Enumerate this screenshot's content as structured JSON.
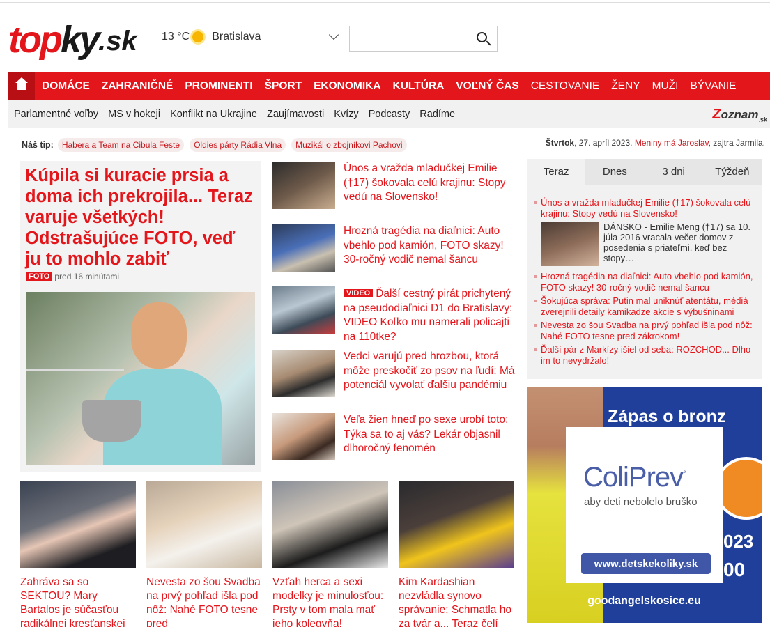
{
  "header": {
    "logo_parts": [
      "top",
      "ky",
      ".sk"
    ],
    "weather": {
      "temp": "13 °C",
      "city": "Bratislava"
    },
    "search": {
      "placeholder": ""
    }
  },
  "nav": {
    "items": [
      "DOMÁCE",
      "ZAHRANIČNÉ",
      "PROMINENTI",
      "ŠPORT",
      "EKONOMIKA",
      "KULTÚRA",
      "VOĽNÝ ČAS",
      "CESTOVANIE",
      "ŽENY",
      "MUŽI",
      "BÝVANIE"
    ]
  },
  "subnav": {
    "items": [
      "Parlamentné voľby",
      "MS v hokeji",
      "Konflikt na Ukrajine",
      "Zaujímavosti",
      "Kvízy",
      "Podcasty",
      "Radíme"
    ],
    "partner": {
      "z": "Z",
      "rest": "oznam",
      "tld": ".sk"
    }
  },
  "tips": {
    "label": "Náš tip:",
    "chips": [
      "Habera a Team na Cibula Feste",
      "Oldies párty Rádia Vlna",
      "Muzikál o zbojníkovi Pachovi"
    ]
  },
  "dateline": {
    "day": "Štvrtok",
    "date": ", 27. apríl 2023.",
    "names": "Meniny má Jaroslav",
    "tomorrow": ", zajtra Jarmila."
  },
  "lead": {
    "title": "Kúpila si kuracie prsia a doma ich prekrojila... Teraz varuje všetkých! Odstrašujúce FOTO, veď ju to mohlo zabiť",
    "badge": "FOTO",
    "time": "pred 16 minútami"
  },
  "mid_list": [
    {
      "text": "Únos a vražda mladučkej Emilie (†17) šokovala celú krajinu: Stopy vedú na Slovensko!",
      "badge": ""
    },
    {
      "text": "Hrozná tragédia na diaľnici: Auto vbehlo pod kamión, FOTO skazy! 30-ročný vodič nemal šancu",
      "badge": ""
    },
    {
      "text": "Ďalší cestný pirát prichytený na pseudodiaľnici D1 do Bratislavy: VIDEO Koľko mu namerali policajti na 110tke?",
      "badge": "VIDEO"
    },
    {
      "text": "Vedci varujú pred hrozbou, ktorá môže preskočiť zo psov na ľudí: Má potenciál vyvolať ďalšiu pandémiu",
      "badge": ""
    },
    {
      "text": "Veľa žien hneď po sexe urobí toto: Týka sa to aj vás? Lekár objasnil dlhoročný fenomén",
      "badge": ""
    }
  ],
  "cards": [
    {
      "text": "Zahráva sa so SEKTOU? Mary Bartalos je súčasťou radikálnej kresťanskej"
    },
    {
      "text": "Nevesta zo šou Svadba na prvý pohľad išla pod nôž: Nahé FOTO tesne pred"
    },
    {
      "text": "Vzťah herca a sexi modelky je minulosťou: Prsty v tom mala mať jeho kolegyňa!"
    },
    {
      "text": "Kim Kardashian nezvládla synovo správanie: Schmatla ho za tvár a... Teraz čelí"
    }
  ],
  "sidebar": {
    "tabs": [
      "Teraz",
      "Dnes",
      "3 dni",
      "Týždeň"
    ],
    "active_tab": "Teraz",
    "item_first": "Únos a vražda mladučkej Emilie (†17) šokovala celú krajinu: Stopy vedú na Slovensko!",
    "featured_text": "DÁNSKO - Emilie Meng (†17) sa 10. júla 2016 vracala večer domov z posedenia s priateľmi, keď bez stopy…",
    "items_rest": [
      "Hrozná tragédia na diaľnici: Auto vbehlo pod kamión, FOTO skazy! 30-ročný vodič nemal šancu",
      "Šokujúca správa: Putin mal uniknúť atentátu, médiá zverejnili detaily kamikadze akcie s výbušninami",
      "Nevesta zo šou Svadba na prvý pohľad išla pod nôž: Nahé FOTO tesne pred zákrokom!",
      "Ďalší pár z Markízy išiel od seba: ROZCHOD... Dlho im to nevydržalo!"
    ]
  },
  "ad": {
    "headline": "Zápas o bronz",
    "brand": "ColiPrev",
    "brand_mark": "°",
    "tagline": "aby deti nebolelo bruško",
    "url": "www.detskekoliky.sk",
    "year_part": "023",
    "digits": "00",
    "footer_site": "goodangelskosice.eu"
  }
}
